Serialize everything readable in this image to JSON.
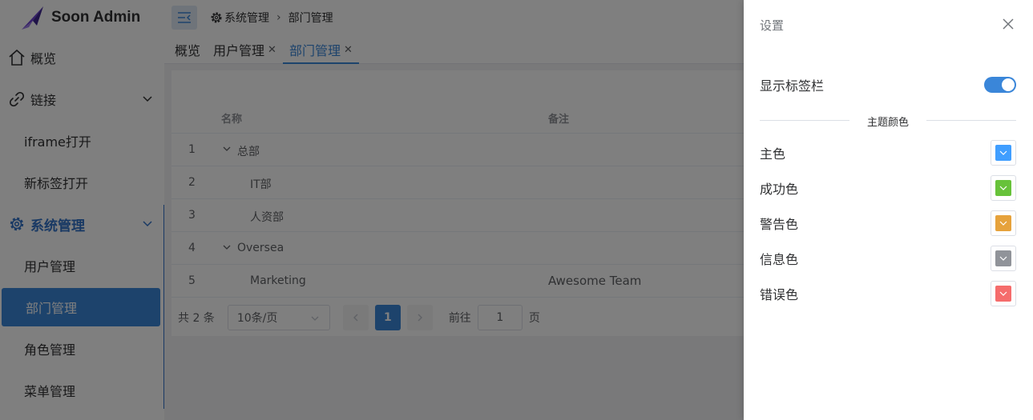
{
  "app": {
    "title": "Soon Admin"
  },
  "sidebar": {
    "items": [
      {
        "label": "概览",
        "icon": "home-icon"
      },
      {
        "label": "链接",
        "icon": "link-icon"
      },
      {
        "label": "iframe打开"
      },
      {
        "label": "新标签打开"
      },
      {
        "label": "系统管理",
        "icon": "gear-icon"
      },
      {
        "label": "用户管理"
      },
      {
        "label": "部门管理"
      },
      {
        "label": "角色管理"
      },
      {
        "label": "菜单管理"
      }
    ]
  },
  "header": {
    "breadcrumb": [
      "系统管理",
      "部门管理"
    ]
  },
  "tabs": [
    {
      "label": "概览",
      "closable": false
    },
    {
      "label": "用户管理",
      "closable": true
    },
    {
      "label": "部门管理",
      "closable": true,
      "active": true
    }
  ],
  "table": {
    "columns": [
      "名称",
      "备注"
    ],
    "rows": [
      {
        "index": "1",
        "name": "总部",
        "remark": "",
        "expandable": true
      },
      {
        "index": "2",
        "name": "IT部",
        "remark": ""
      },
      {
        "index": "3",
        "name": "人资部",
        "remark": ""
      },
      {
        "index": "4",
        "name": "Oversea",
        "remark": "",
        "expandable": true
      },
      {
        "index": "5",
        "name": "Marketing",
        "remark": "Awesome Team"
      }
    ]
  },
  "pagination": {
    "total_text": "共 2 条",
    "page_size": "10条/页",
    "current_page": "1",
    "goto_label": "前往",
    "goto_value": "1",
    "page_suffix": "页"
  },
  "drawer": {
    "title": "设置",
    "show_tabs_label": "显示标签栏",
    "show_tabs_on": true,
    "theme_section": "主题颜色",
    "colors": [
      {
        "label": "主色",
        "value": "#409eff"
      },
      {
        "label": "成功色",
        "value": "#67c23a"
      },
      {
        "label": "警告色",
        "value": "#e6a23c"
      },
      {
        "label": "信息色",
        "value": "#909399"
      },
      {
        "label": "错误色",
        "value": "#f56c6c"
      }
    ]
  }
}
